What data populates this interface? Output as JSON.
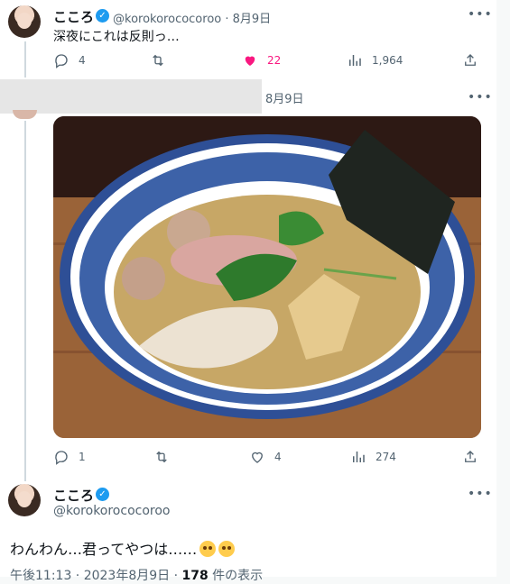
{
  "tweet1": {
    "display_name": "こころ",
    "handle_date": "@korokorococoroo · 8月9日",
    "text": "深夜にこれは反則っ…",
    "replies": "4",
    "retweets": "",
    "likes": "22",
    "views": "1,964"
  },
  "tweet2": {
    "date": "8月9日",
    "replies": "1",
    "retweets": "",
    "likes": "4",
    "views": "274"
  },
  "tweet3": {
    "display_name": "こころ",
    "handle": "@korokorococoroo",
    "text": "わんわん…君ってやつは……",
    "meta_time": "午後11:13 · 2023年8月9日 · ",
    "meta_views": "178",
    "meta_suffix": " 件の表示"
  },
  "icons": {
    "reply": "reply-icon",
    "retweet": "retweet-icon",
    "like": "heart-icon",
    "views": "views-icon",
    "share": "share-icon",
    "more": "more-icon",
    "verified": "verified-badge-icon"
  },
  "colors": {
    "accent": "#1d9bf0",
    "like": "#f91880",
    "secondary_text": "#536471"
  }
}
